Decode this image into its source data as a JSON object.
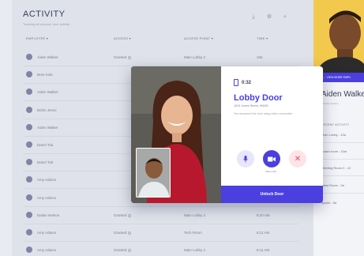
{
  "header": {
    "title": "ACTIVITY",
    "subtitle": "Tracking all keycard, door activity"
  },
  "tools": [
    {
      "icon": "download-icon",
      "glyph": "⤓"
    },
    {
      "icon": "filter-icon",
      "glyph": "⚙"
    },
    {
      "icon": "search-icon",
      "glyph": "⌕"
    }
  ],
  "table": {
    "columns": [
      "EMPLOYEE ▾",
      "ACCESS ▾",
      "ACCESS POINT ▾",
      "TIME ▾"
    ],
    "rows": [
      {
        "name": "Aiden Walker",
        "access": "Granted",
        "point": "Main Lobby 2",
        "time": "10a"
      },
      {
        "name": "Bree Kole",
        "access": "",
        "point": "",
        "time": ""
      },
      {
        "name": "Aiden Walker",
        "access": "",
        "point": "",
        "time": ""
      },
      {
        "name": "Bohin Jenez",
        "access": "",
        "point": "",
        "time": ""
      },
      {
        "name": "Aiden Walker",
        "access": "",
        "point": "",
        "time": ""
      },
      {
        "name": "Danel Tuk",
        "access": "",
        "point": "",
        "time": ""
      },
      {
        "name": "Danel Tuk",
        "access": "",
        "point": "",
        "time": ""
      },
      {
        "name": "Amy Adams",
        "access": "",
        "point": "",
        "time": ""
      },
      {
        "name": "Amy Adams",
        "access": "",
        "point": "",
        "time": ""
      },
      {
        "name": "Dalian Netson",
        "access": "Granted",
        "point": "Main Lobby 2",
        "time": "8:20 AM"
      },
      {
        "name": "Amy Adams",
        "access": "Granted",
        "point": "Tech Room",
        "time": "8:11 AM"
      },
      {
        "name": "Amy Adams",
        "access": "Granted",
        "point": "Main Lobby 2",
        "time": "8:11 AM"
      }
    ]
  },
  "panel": {
    "bar_label": "← VIEW MORE EMPL",
    "name": "Aiden Walke",
    "sub": "Security System",
    "activity_label": "RECENT ACTIVITY",
    "activity": [
      "Main Lobby - 10a",
      "Board room - 10ar",
      "Meeting Room 2 - 12",
      "West Room - 9a",
      "Apollo - 9a"
    ]
  },
  "modal": {
    "timer": "0:32",
    "door_title": "Lobby Door",
    "address": "1024 Jones Street, 90028",
    "message": "You answered the door using video connection",
    "video_caption": "Video Call",
    "unlock_label": "Unlock Door",
    "colors": {
      "accent": "#4b3fe0",
      "end_call": "#e64a62"
    }
  }
}
